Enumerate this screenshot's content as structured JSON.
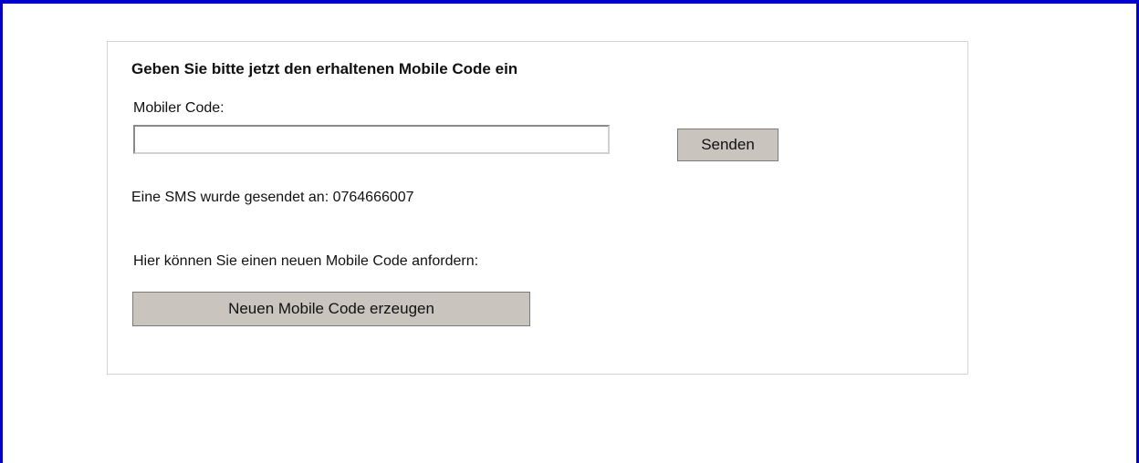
{
  "colors": {
    "frame_border": "#0000cc",
    "panel_border": "#d4d4d4",
    "button_bg": "#c9c4bd"
  },
  "form": {
    "heading": "Geben Sie bitte jetzt den erhaltenen Mobile Code ein",
    "code_label": "Mobiler Code:",
    "code_value": "",
    "send_label": "Senden",
    "sms_info": "Eine SMS wurde gesendet an: 0764666007",
    "request_info": "Hier können Sie einen neuen Mobile Code anfordern:",
    "new_code_label": "Neuen Mobile Code erzeugen"
  }
}
